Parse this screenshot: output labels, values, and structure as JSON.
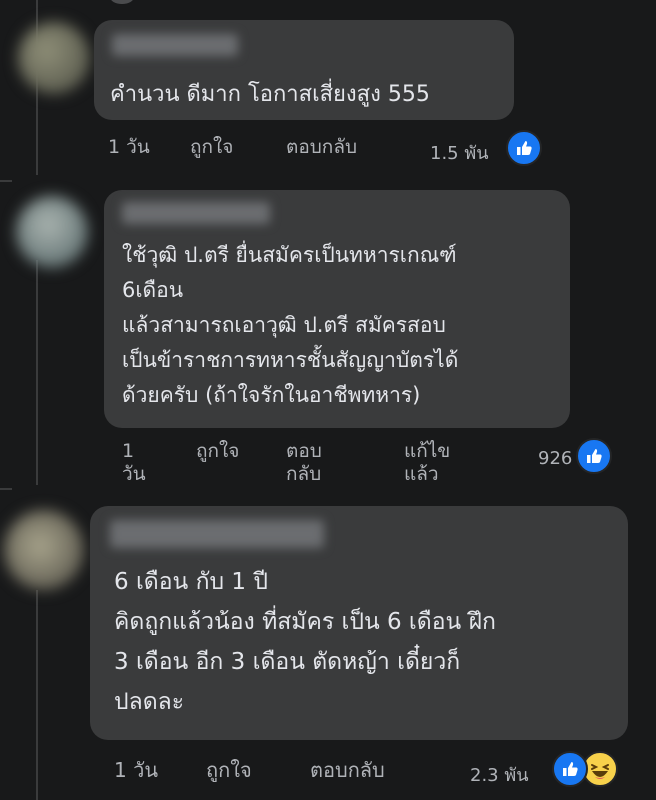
{
  "comments": [
    {
      "text": "คำนวน ดีมาก โอกาสเสี่ยงสูง 555",
      "actions": {
        "time": "1 วัน",
        "like": "ถูกใจ",
        "reply": "ตอบกลับ"
      },
      "reactions": {
        "count": "1.5 พัน",
        "types": [
          "like-icon"
        ]
      }
    },
    {
      "text": "ใช้วุฒิ ป.ตรี ยื่นสมัครเป็นทหารเกณฑ์\n6เดือน\nแล้วสามารถเอาวุฒิ ป.ตรี สมัครสอบ\nเป็นข้าราชการทหารชั้นสัญญาบัตรได้\nด้วยครับ (ถ้าใจรักในอาชีพทหาร)",
      "actions": {
        "time": "1 วัน",
        "like": "ถูกใจ",
        "reply": "ตอบกลับ",
        "edited": "แก้ไขแล้ว"
      },
      "reactions": {
        "count": "926",
        "types": [
          "like-icon"
        ]
      }
    },
    {
      "text": "6 เดือน กับ 1 ปี\nคิดถูกแล้วน้อง ที่สมัคร เป็น 6 เดือน ฝึก\n3 เดือน อีก 3 เดือน ตัดหญ้า เดี๋ยวก็\nปลดละ",
      "actions": {
        "time": "1 วัน",
        "like": "ถูกใจ",
        "reply": "ตอบกลับ"
      },
      "reactions": {
        "count": "2.3 พัน",
        "types": [
          "like-icon",
          "haha-icon"
        ]
      }
    }
  ],
  "colors": {
    "background": "#18191a",
    "bubble": "#3a3b3c",
    "text": "#e4e6eb",
    "secondary_text": "#b0b3b8",
    "like_blue": "#1877f2",
    "haha_yellow": "#f7d14b"
  }
}
